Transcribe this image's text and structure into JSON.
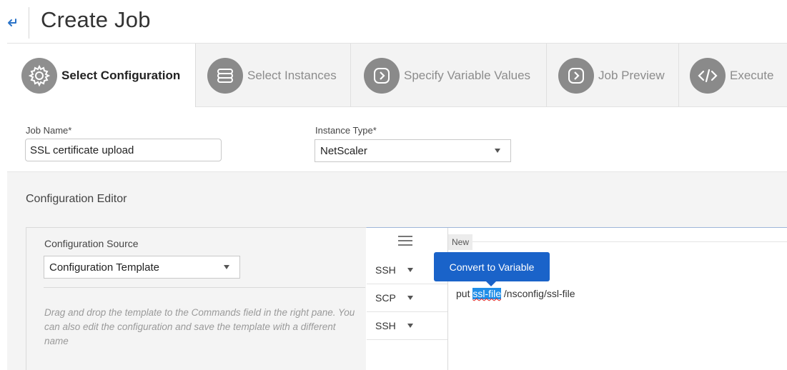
{
  "header": {
    "title": "Create Job"
  },
  "wizard": {
    "steps": [
      {
        "label": "Select Configuration",
        "icon": "gear-icon",
        "active": true
      },
      {
        "label": "Select Instances",
        "icon": "server-icon",
        "active": false
      },
      {
        "label": "Specify Variable Values",
        "icon": "chevron-right-icon",
        "active": false
      },
      {
        "label": "Job Preview",
        "icon": "chevron-right-icon",
        "active": false
      },
      {
        "label": "Execute",
        "icon": "code-icon",
        "active": false
      }
    ]
  },
  "form": {
    "job_name_label": "Job Name*",
    "job_name_value": "SSL certificate upload",
    "instance_type_label": "Instance Type*",
    "instance_type_value": "NetScaler"
  },
  "editor": {
    "title": "Configuration Editor",
    "source_label": "Configuration Source",
    "source_value": "Configuration Template",
    "hint": "Drag and drop the template to the Commands field in the right pane. You can also edit the configuration and save the template with a different name",
    "protocols": [
      "SSH",
      "SCP",
      "SSH"
    ],
    "new_tab": "New",
    "tooltip": "Convert to Variable",
    "command": {
      "prefix": "put ",
      "selected": "ssl-file",
      "suffix": " /nsconfig/ssl-file"
    }
  }
}
